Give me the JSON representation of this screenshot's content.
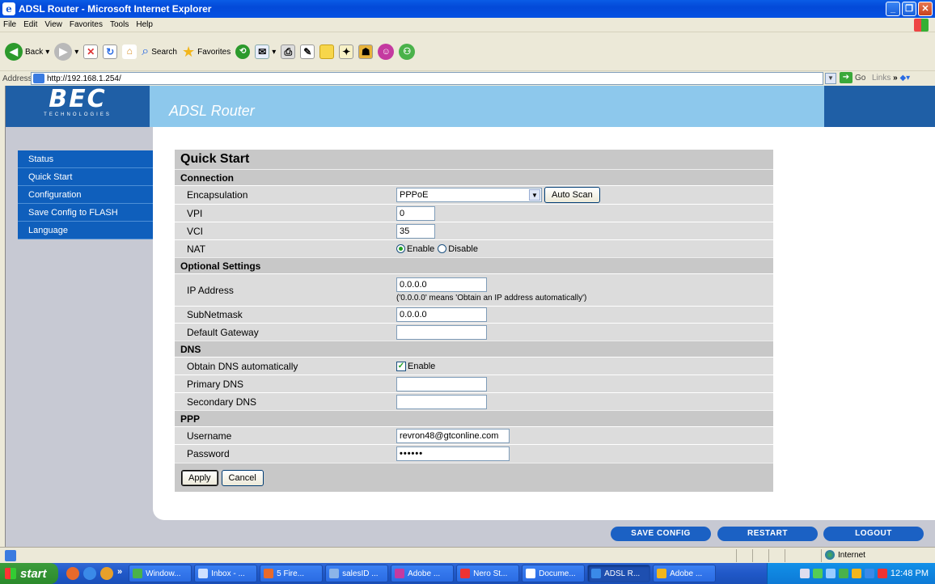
{
  "window": {
    "title": "ADSL Router - Microsoft Internet Explorer"
  },
  "menu": [
    "File",
    "Edit",
    "View",
    "Favorites",
    "Tools",
    "Help"
  ],
  "toolbar": {
    "back": "Back",
    "search": "Search",
    "favorites": "Favorites"
  },
  "address": {
    "label": "Address",
    "url": "http://192.168.1.254/",
    "go": "Go",
    "links": "Links"
  },
  "router": {
    "logo": "BEC",
    "logo_sub": "TECHNOLOGIES",
    "title": "ADSL Router",
    "nav": [
      "Status",
      "Quick Start",
      "Configuration",
      "Save Config to FLASH",
      "Language"
    ],
    "bottom_buttons": {
      "save": "SAVE CONFIG",
      "restart": "RESTART",
      "logout": "LOGOUT"
    }
  },
  "form": {
    "title": "Quick Start",
    "sections": {
      "connection": "Connection",
      "optional": "Optional Settings",
      "dns": "DNS",
      "ppp": "PPP"
    },
    "labels": {
      "encapsulation": "Encapsulation",
      "vpi": "VPI",
      "vci": "VCI",
      "nat": "NAT",
      "ip": "IP Address",
      "subnet": "SubNetmask",
      "gateway": "Default Gateway",
      "obtain_dns": "Obtain DNS automatically",
      "primary_dns": "Primary DNS",
      "secondary_dns": "Secondary DNS",
      "username": "Username",
      "password": "Password"
    },
    "values": {
      "encapsulation": "PPPoE",
      "vpi": "0",
      "vci": "35",
      "nat_enable": "Enable",
      "nat_disable": "Disable",
      "ip": "0.0.0.0",
      "ip_note": "('0.0.0.0' means 'Obtain an IP address automatically')",
      "subnet": "0.0.0.0",
      "gateway": "",
      "dns_enable": "Enable",
      "primary_dns": "",
      "secondary_dns": "",
      "username": "revron48@gtconline.com",
      "password": "••••••"
    },
    "buttons": {
      "auto_scan": "Auto Scan",
      "apply": "Apply",
      "cancel": "Cancel"
    }
  },
  "status": {
    "zone": "Internet"
  },
  "taskbar": {
    "start": "start",
    "tasks": [
      "Window...",
      "Inbox - ...",
      "5 Fire...",
      "salesID ...",
      "Adobe ...",
      "Nero St...",
      "Docume...",
      "ADSL R...",
      "Adobe ..."
    ],
    "clock": "12:48 PM"
  },
  "colors": {
    "nav_blue": "#0f5fbc",
    "header_blue": "#8dc8ec",
    "logo_blue": "#1f5fa6",
    "form_gray": "#c8c8c8"
  }
}
